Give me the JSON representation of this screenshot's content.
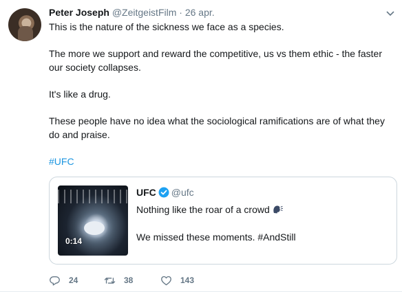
{
  "tweet": {
    "author_name": "Peter Joseph",
    "author_handle": "@ZeitgeistFilm",
    "separator": "·",
    "date": "26 apr.",
    "paragraphs": [
      "This is the nature of the sickness we face as a species.",
      "The more we support and reward the competitive, us vs them ethic - the faster our society collapses.",
      "It's like a drug.",
      "These people have no idea what the sociological ramifications are of what they do and praise."
    ],
    "hashtag": "#UFC"
  },
  "quoted_tweet": {
    "author_name": "UFC",
    "author_handle": "@ufc",
    "verified": true,
    "video_duration": "0:14",
    "line1": "Nothing like the roar of a crowd",
    "line2": "We missed these moments. #AndStill",
    "emoji_icon": "speaking-head-icon"
  },
  "actions": {
    "replies": "24",
    "retweets": "38",
    "likes": "143"
  },
  "colors": {
    "link": "#1b95e0",
    "muted": "#657786",
    "border": "#ccd6dd"
  }
}
